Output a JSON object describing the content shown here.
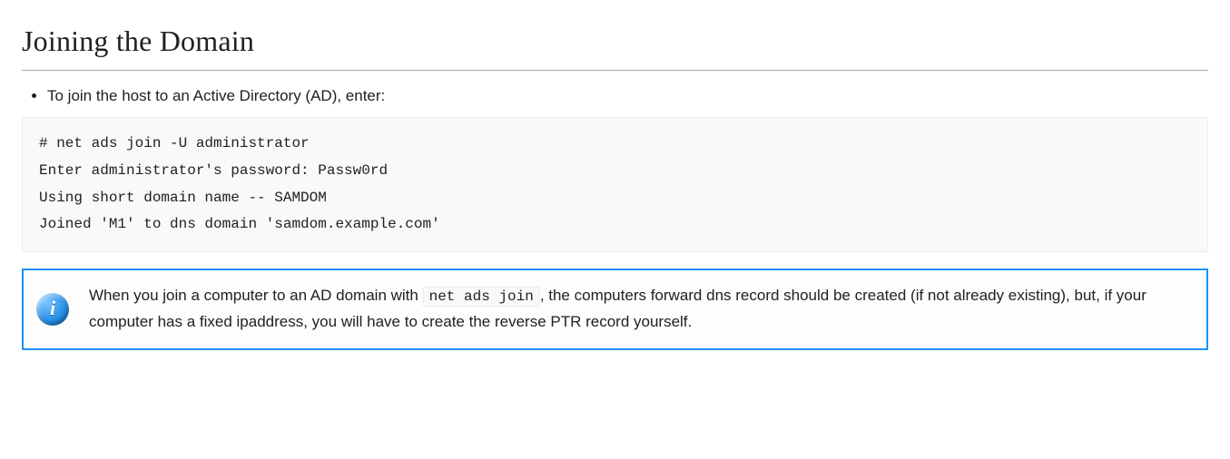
{
  "heading": "Joining the Domain",
  "bullet": "To join the host to an Active Directory (AD), enter:",
  "code": "# net ads join -U administrator\nEnter administrator's password: Passw0rd\nUsing short domain name -- SAMDOM\nJoined 'M1' to dns domain 'samdom.example.com'",
  "info_icon_letter": "i",
  "note": {
    "before": "When you join a computer to an AD domain with ",
    "code": "net ads join",
    "after": ", the computers forward dns record should be created (if not already existing), but, if your computer has a fixed ipaddress, you will have to create the reverse PTR record yourself."
  }
}
